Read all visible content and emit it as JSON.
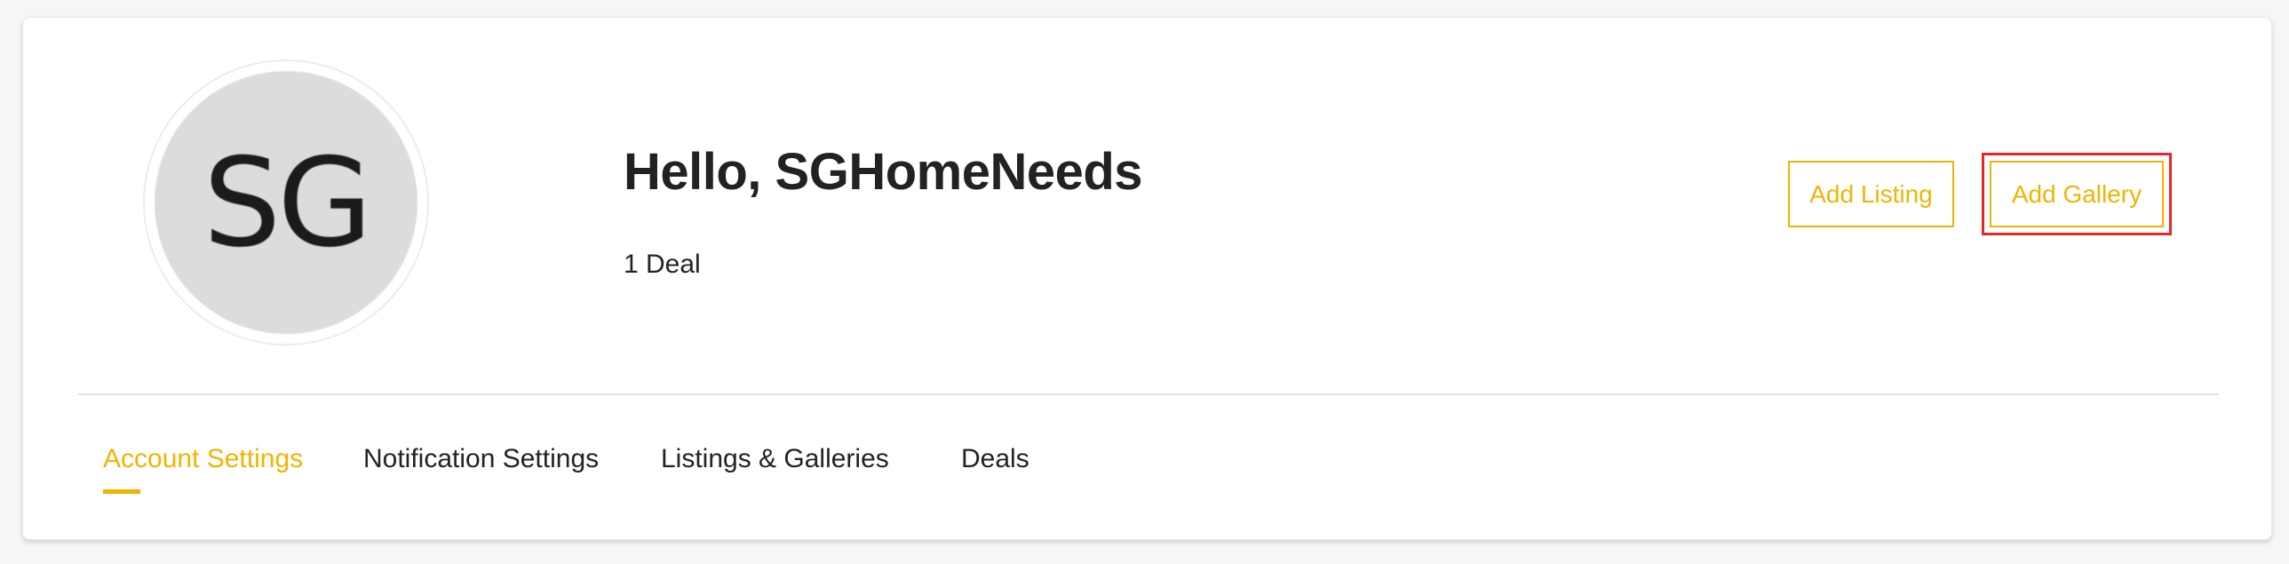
{
  "profile": {
    "avatar_initials": "SG",
    "greeting": "Hello, SGHomeNeeds",
    "deal_count": "1 Deal"
  },
  "actions": {
    "add_listing_label": "Add Listing",
    "add_gallery_label": "Add Gallery"
  },
  "tabs": [
    {
      "label": "Account Settings",
      "active": true
    },
    {
      "label": "Notification Settings",
      "active": false
    },
    {
      "label": "Listings & Galleries",
      "active": false
    },
    {
      "label": "Deals",
      "active": false
    }
  ],
  "colors": {
    "accent": "#f0b400",
    "highlight_outline": "#e8262a",
    "avatar_background": "#dcdcdc",
    "text": "#232323"
  }
}
